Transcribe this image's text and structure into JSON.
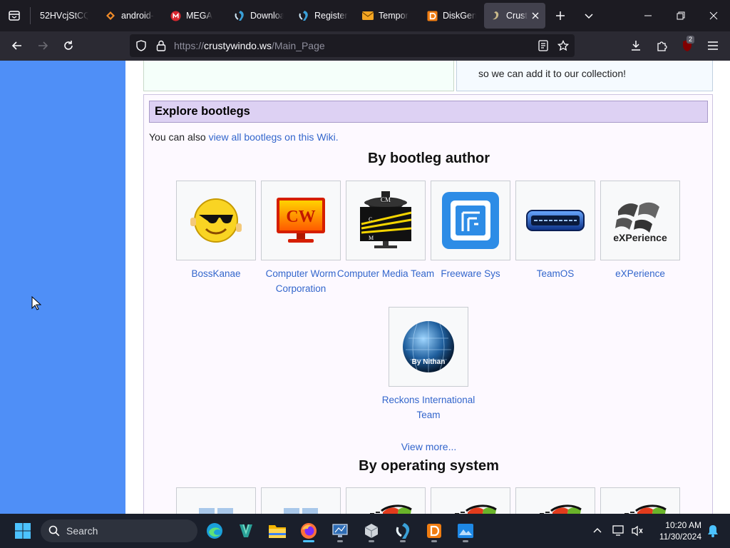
{
  "browser": {
    "tabs": [
      {
        "label": "52HVcjStCQ",
        "icon": "page-icon"
      },
      {
        "label": "android-",
        "icon": "android-diamond-icon"
      },
      {
        "label": "MEGA",
        "icon": "mega-icon"
      },
      {
        "label": "Downloa",
        "icon": "bootleg-site-icon"
      },
      {
        "label": "Register",
        "icon": "bootleg-site-icon"
      },
      {
        "label": "Tempor",
        "icon": "mail-icon"
      },
      {
        "label": "DiskGen",
        "icon": "diskgenius-icon"
      },
      {
        "label": "Crust",
        "icon": "crusty-icon",
        "active": true
      }
    ],
    "url_prefix": "https://",
    "url_host": "crustywindo.ws",
    "url_path": "/Main_Page",
    "extension_badge": "2"
  },
  "page": {
    "previous_box_text": "so we can add it to our collection!",
    "explore": {
      "heading": "Explore bootlegs",
      "note_prefix": "You can also ",
      "note_link": "view all bootlegs on this Wiki."
    },
    "by_author": {
      "title": "By bootleg author",
      "items": [
        {
          "label": "BossKanae",
          "logo": "smiley-sunglasses-logo"
        },
        {
          "label": "Computer Worm Corporation",
          "logo": "cw-monitor-logo"
        },
        {
          "label": "Computer Media Team",
          "logo": "cm-monitor-logo"
        },
        {
          "label": "Freeware Sys",
          "logo": "freeware-sys-logo"
        },
        {
          "label": "TeamOS",
          "logo": "teamos-logo"
        },
        {
          "label": "eXPerience",
          "logo": "experience-logo",
          "logo_text": "eXPerience"
        },
        {
          "label": "Reckons International Team",
          "logo": "globe-logo",
          "logo_text": "By Nithan"
        }
      ],
      "view_more": "View more..."
    },
    "by_os": {
      "title": "By operating system"
    }
  },
  "taskbar": {
    "search_label": "Search",
    "time": "10:20 AM",
    "date": "11/30/2024"
  }
}
